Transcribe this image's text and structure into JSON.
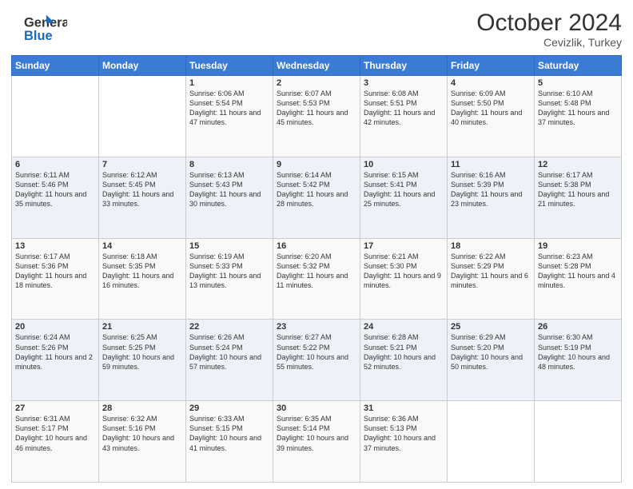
{
  "header": {
    "logo_line1": "General",
    "logo_line2": "Blue",
    "month": "October 2024",
    "location": "Cevizlik, Turkey"
  },
  "days_of_week": [
    "Sunday",
    "Monday",
    "Tuesday",
    "Wednesday",
    "Thursday",
    "Friday",
    "Saturday"
  ],
  "weeks": [
    [
      {
        "day": "",
        "sunrise": "",
        "sunset": "",
        "daylight": ""
      },
      {
        "day": "",
        "sunrise": "",
        "sunset": "",
        "daylight": ""
      },
      {
        "day": "1",
        "sunrise": "Sunrise: 6:06 AM",
        "sunset": "Sunset: 5:54 PM",
        "daylight": "Daylight: 11 hours and 47 minutes."
      },
      {
        "day": "2",
        "sunrise": "Sunrise: 6:07 AM",
        "sunset": "Sunset: 5:53 PM",
        "daylight": "Daylight: 11 hours and 45 minutes."
      },
      {
        "day": "3",
        "sunrise": "Sunrise: 6:08 AM",
        "sunset": "Sunset: 5:51 PM",
        "daylight": "Daylight: 11 hours and 42 minutes."
      },
      {
        "day": "4",
        "sunrise": "Sunrise: 6:09 AM",
        "sunset": "Sunset: 5:50 PM",
        "daylight": "Daylight: 11 hours and 40 minutes."
      },
      {
        "day": "5",
        "sunrise": "Sunrise: 6:10 AM",
        "sunset": "Sunset: 5:48 PM",
        "daylight": "Daylight: 11 hours and 37 minutes."
      }
    ],
    [
      {
        "day": "6",
        "sunrise": "Sunrise: 6:11 AM",
        "sunset": "Sunset: 5:46 PM",
        "daylight": "Daylight: 11 hours and 35 minutes."
      },
      {
        "day": "7",
        "sunrise": "Sunrise: 6:12 AM",
        "sunset": "Sunset: 5:45 PM",
        "daylight": "Daylight: 11 hours and 33 minutes."
      },
      {
        "day": "8",
        "sunrise": "Sunrise: 6:13 AM",
        "sunset": "Sunset: 5:43 PM",
        "daylight": "Daylight: 11 hours and 30 minutes."
      },
      {
        "day": "9",
        "sunrise": "Sunrise: 6:14 AM",
        "sunset": "Sunset: 5:42 PM",
        "daylight": "Daylight: 11 hours and 28 minutes."
      },
      {
        "day": "10",
        "sunrise": "Sunrise: 6:15 AM",
        "sunset": "Sunset: 5:41 PM",
        "daylight": "Daylight: 11 hours and 25 minutes."
      },
      {
        "day": "11",
        "sunrise": "Sunrise: 6:16 AM",
        "sunset": "Sunset: 5:39 PM",
        "daylight": "Daylight: 11 hours and 23 minutes."
      },
      {
        "day": "12",
        "sunrise": "Sunrise: 6:17 AM",
        "sunset": "Sunset: 5:38 PM",
        "daylight": "Daylight: 11 hours and 21 minutes."
      }
    ],
    [
      {
        "day": "13",
        "sunrise": "Sunrise: 6:17 AM",
        "sunset": "Sunset: 5:36 PM",
        "daylight": "Daylight: 11 hours and 18 minutes."
      },
      {
        "day": "14",
        "sunrise": "Sunrise: 6:18 AM",
        "sunset": "Sunset: 5:35 PM",
        "daylight": "Daylight: 11 hours and 16 minutes."
      },
      {
        "day": "15",
        "sunrise": "Sunrise: 6:19 AM",
        "sunset": "Sunset: 5:33 PM",
        "daylight": "Daylight: 11 hours and 13 minutes."
      },
      {
        "day": "16",
        "sunrise": "Sunrise: 6:20 AM",
        "sunset": "Sunset: 5:32 PM",
        "daylight": "Daylight: 11 hours and 11 minutes."
      },
      {
        "day": "17",
        "sunrise": "Sunrise: 6:21 AM",
        "sunset": "Sunset: 5:30 PM",
        "daylight": "Daylight: 11 hours and 9 minutes."
      },
      {
        "day": "18",
        "sunrise": "Sunrise: 6:22 AM",
        "sunset": "Sunset: 5:29 PM",
        "daylight": "Daylight: 11 hours and 6 minutes."
      },
      {
        "day": "19",
        "sunrise": "Sunrise: 6:23 AM",
        "sunset": "Sunset: 5:28 PM",
        "daylight": "Daylight: 11 hours and 4 minutes."
      }
    ],
    [
      {
        "day": "20",
        "sunrise": "Sunrise: 6:24 AM",
        "sunset": "Sunset: 5:26 PM",
        "daylight": "Daylight: 11 hours and 2 minutes."
      },
      {
        "day": "21",
        "sunrise": "Sunrise: 6:25 AM",
        "sunset": "Sunset: 5:25 PM",
        "daylight": "Daylight: 10 hours and 59 minutes."
      },
      {
        "day": "22",
        "sunrise": "Sunrise: 6:26 AM",
        "sunset": "Sunset: 5:24 PM",
        "daylight": "Daylight: 10 hours and 57 minutes."
      },
      {
        "day": "23",
        "sunrise": "Sunrise: 6:27 AM",
        "sunset": "Sunset: 5:22 PM",
        "daylight": "Daylight: 10 hours and 55 minutes."
      },
      {
        "day": "24",
        "sunrise": "Sunrise: 6:28 AM",
        "sunset": "Sunset: 5:21 PM",
        "daylight": "Daylight: 10 hours and 52 minutes."
      },
      {
        "day": "25",
        "sunrise": "Sunrise: 6:29 AM",
        "sunset": "Sunset: 5:20 PM",
        "daylight": "Daylight: 10 hours and 50 minutes."
      },
      {
        "day": "26",
        "sunrise": "Sunrise: 6:30 AM",
        "sunset": "Sunset: 5:19 PM",
        "daylight": "Daylight: 10 hours and 48 minutes."
      }
    ],
    [
      {
        "day": "27",
        "sunrise": "Sunrise: 6:31 AM",
        "sunset": "Sunset: 5:17 PM",
        "daylight": "Daylight: 10 hours and 46 minutes."
      },
      {
        "day": "28",
        "sunrise": "Sunrise: 6:32 AM",
        "sunset": "Sunset: 5:16 PM",
        "daylight": "Daylight: 10 hours and 43 minutes."
      },
      {
        "day": "29",
        "sunrise": "Sunrise: 6:33 AM",
        "sunset": "Sunset: 5:15 PM",
        "daylight": "Daylight: 10 hours and 41 minutes."
      },
      {
        "day": "30",
        "sunrise": "Sunrise: 6:35 AM",
        "sunset": "Sunset: 5:14 PM",
        "daylight": "Daylight: 10 hours and 39 minutes."
      },
      {
        "day": "31",
        "sunrise": "Sunrise: 6:36 AM",
        "sunset": "Sunset: 5:13 PM",
        "daylight": "Daylight: 10 hours and 37 minutes."
      },
      {
        "day": "",
        "sunrise": "",
        "sunset": "",
        "daylight": ""
      },
      {
        "day": "",
        "sunrise": "",
        "sunset": "",
        "daylight": ""
      }
    ]
  ]
}
